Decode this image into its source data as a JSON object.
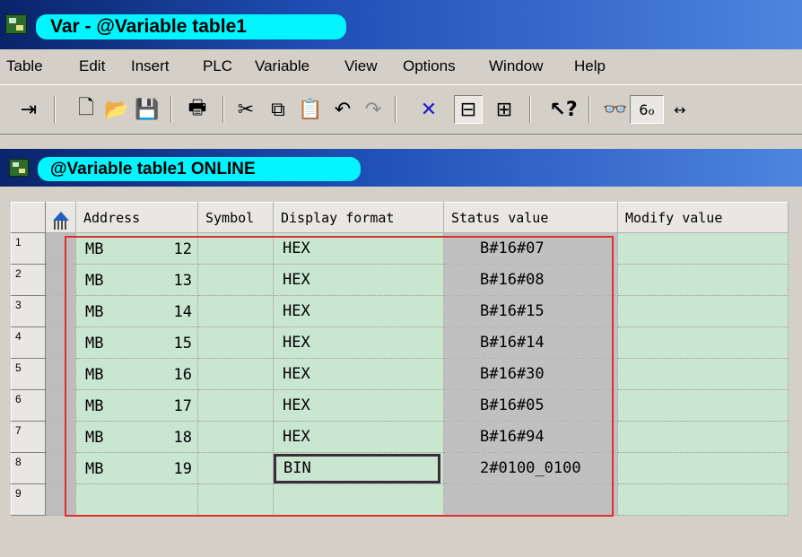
{
  "window": {
    "title": "Var - @Variable table1",
    "icon": "var-app-icon"
  },
  "menu": [
    "Table",
    "Edit",
    "Insert",
    "PLC",
    "Variable",
    "View",
    "Options",
    "Window",
    "Help"
  ],
  "toolbar": {
    "icons": [
      "pin-icon",
      "new-icon",
      "open-icon",
      "save-icon",
      "print-icon",
      "cut-icon",
      "copy-icon",
      "paste-icon",
      "undo-icon",
      "redo-icon",
      "delete-icon",
      "monitor-icon",
      "connect-icon",
      "help-pointer-icon",
      "glasses-icon",
      "monitor-variable-icon",
      "modify-icon"
    ]
  },
  "inner_window": {
    "title": "@Variable table1  ONLINE"
  },
  "table": {
    "columns": [
      "Address",
      "Symbol",
      "Display format",
      "Status value",
      "Modify value"
    ],
    "rows": [
      {
        "num": "1",
        "op": "MB",
        "addr": "12",
        "symbol": "",
        "format": "HEX",
        "status": "B#16#07",
        "modify": ""
      },
      {
        "num": "2",
        "op": "MB",
        "addr": "13",
        "symbol": "",
        "format": "HEX",
        "status": "B#16#08",
        "modify": ""
      },
      {
        "num": "3",
        "op": "MB",
        "addr": "14",
        "symbol": "",
        "format": "HEX",
        "status": "B#16#15",
        "modify": ""
      },
      {
        "num": "4",
        "op": "MB",
        "addr": "15",
        "symbol": "",
        "format": "HEX",
        "status": "B#16#14",
        "modify": ""
      },
      {
        "num": "5",
        "op": "MB",
        "addr": "16",
        "symbol": "",
        "format": "HEX",
        "status": "B#16#30",
        "modify": ""
      },
      {
        "num": "6",
        "op": "MB",
        "addr": "17",
        "symbol": "",
        "format": "HEX",
        "status": "B#16#05",
        "modify": ""
      },
      {
        "num": "7",
        "op": "MB",
        "addr": "18",
        "symbol": "",
        "format": "HEX",
        "status": "B#16#94",
        "modify": ""
      },
      {
        "num": "8",
        "op": "MB",
        "addr": "19",
        "symbol": "",
        "format": "BIN",
        "status": "2#0100_0100",
        "modify": ""
      },
      {
        "num": "9",
        "op": "",
        "addr": "",
        "symbol": "",
        "format": "",
        "status": "",
        "modify": ""
      }
    ]
  },
  "colors": {
    "titlebar": "#0a246a",
    "title_highlight": "#00f5ff",
    "cell_green": "#c9e6d0",
    "status_gray": "#c0c0c0",
    "highlight_frame": "#e0302e"
  }
}
